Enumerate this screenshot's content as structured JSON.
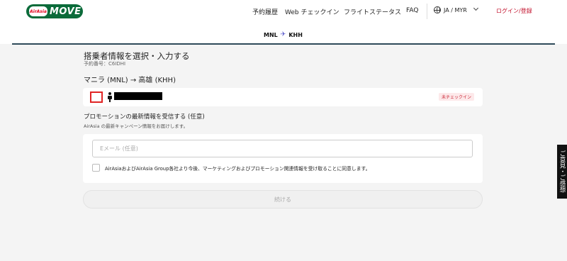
{
  "brand": {
    "small": "AirAsia",
    "name": "MOVE",
    "accent": "#c20f2a",
    "logo_bg": "#0b6b3a"
  },
  "nav": {
    "items": [
      "予約履歴",
      "Web チェックイン",
      "フライトステータス",
      "FAQ"
    ],
    "language": "JA / MYR",
    "login": "ログイン/登録"
  },
  "route_tab": {
    "origin": "MNL",
    "destination": "KHH"
  },
  "page": {
    "title": "搭乗者情報を選択・入力する",
    "booking_ref": "予約番号：C6IDHI",
    "route": "マニラ (MNL) → 高雄 (KHH)"
  },
  "passenger": {
    "status": "未チェックイン"
  },
  "promo": {
    "title": "プロモーションの最新情報を受信する (任意)",
    "subtitle": "AirAsia の最新キャンペーン情報をお届けします。",
    "email_placeholder": "Eメール (任意)",
    "consent": "AirAsiaおよびAirAsia Group各社より今後、マーケティングおよびプロモーション関連情報を受け取ることに同意します。"
  },
  "continue_label": "続ける",
  "feedback": "ご意見・ご感想"
}
